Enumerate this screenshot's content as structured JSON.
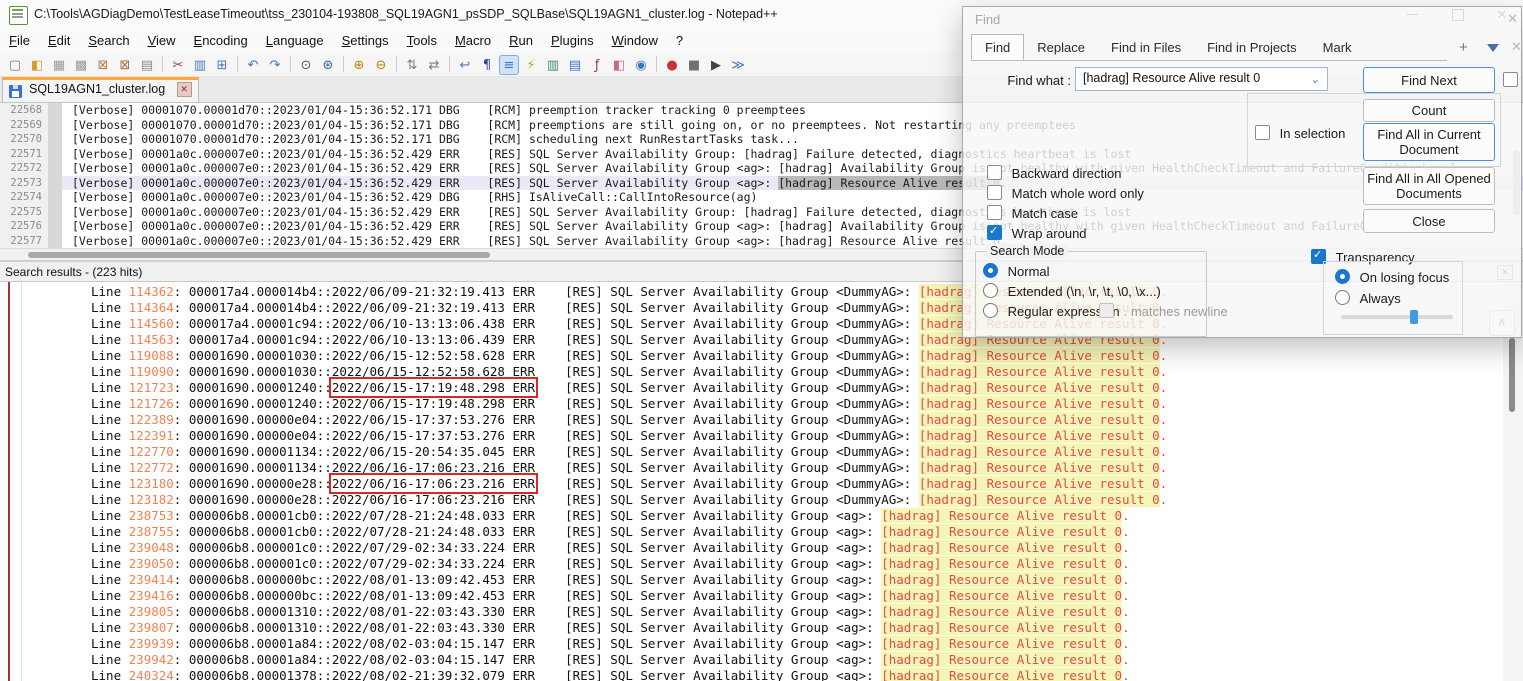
{
  "window": {
    "title": "C:\\Tools\\AGDiagDemo\\TestLeaseTimeout\\tss_230104-193808_SQL19AGN1_psSDP_SQLBase\\SQL19AGN1_cluster.log - Notepad++"
  },
  "menu": {
    "items": [
      "File",
      "Edit",
      "Search",
      "View",
      "Encoding",
      "Language",
      "Settings",
      "Tools",
      "Macro",
      "Run",
      "Plugins",
      "Window",
      "?"
    ]
  },
  "toolbar": {
    "icons": [
      {
        "name": "new-file-icon",
        "glyph": "▢",
        "color": "#7a7a7a"
      },
      {
        "name": "open-file-icon",
        "glyph": "◧",
        "color": "#d79b2e"
      },
      {
        "name": "save-icon",
        "glyph": "▦",
        "color": "#9a9a9a"
      },
      {
        "name": "save-all-icon",
        "glyph": "▩",
        "color": "#9a9a9a"
      },
      {
        "name": "close-file-icon",
        "glyph": "⊠",
        "color": "#b97a4a"
      },
      {
        "name": "close-all-files-icon",
        "glyph": "⊠",
        "color": "#a96a3a"
      },
      {
        "name": "print-icon",
        "glyph": "▤",
        "color": "#8a8a8a",
        "sep_after": true
      },
      {
        "name": "cut-icon",
        "glyph": "✂",
        "color": "#b0392e"
      },
      {
        "name": "copy-icon",
        "glyph": "▥",
        "color": "#4a78c0"
      },
      {
        "name": "paste-icon",
        "glyph": "⊞",
        "color": "#4a78c0",
        "sep_after": true
      },
      {
        "name": "undo-icon",
        "glyph": "↶",
        "color": "#3f74c4"
      },
      {
        "name": "redo-icon",
        "glyph": "↷",
        "color": "#3f74c4",
        "sep_after": true
      },
      {
        "name": "find-icon",
        "glyph": "⊙",
        "color": "#555555"
      },
      {
        "name": "replace-icon",
        "glyph": "⊛",
        "color": "#2f5fa0",
        "sep_after": true
      },
      {
        "name": "zoom-in-icon",
        "glyph": "⊕",
        "color": "#b8860b"
      },
      {
        "name": "zoom-out-icon",
        "glyph": "⊖",
        "color": "#b8860b",
        "sep_after": true
      },
      {
        "name": "sync-vertical-icon",
        "glyph": "⇅",
        "color": "#7a7a7a"
      },
      {
        "name": "sync-horizontal-icon",
        "glyph": "⇄",
        "color": "#7a7a7a",
        "sep_after": true
      },
      {
        "name": "word-wrap-icon",
        "glyph": "↩",
        "color": "#4a78c0"
      },
      {
        "name": "show-all-characters-icon",
        "glyph": "¶",
        "color": "#2b4a9e"
      },
      {
        "name": "indent-guide-icon",
        "glyph": "≡",
        "color": "#3f74c4",
        "pressed": true
      },
      {
        "name": "user-defined-language-icon",
        "glyph": "⚡",
        "color": "#d79b2e"
      },
      {
        "name": "document-map-icon",
        "glyph": "▥",
        "color": "#3f8f5f"
      },
      {
        "name": "document-list-icon",
        "glyph": "▤",
        "color": "#3f74c4"
      },
      {
        "name": "function-list-icon",
        "glyph": "ƒ",
        "color": "#a04040"
      },
      {
        "name": "folder-as-workspace-icon",
        "glyph": "◧",
        "color": "#c46a8a"
      },
      {
        "name": "monitoring-eye-icon",
        "glyph": "◉",
        "color": "#3f74c4",
        "sep_after": true
      },
      {
        "name": "record-macro-icon",
        "glyph": "●",
        "color": "#c83232"
      },
      {
        "name": "stop-macro-icon",
        "glyph": "■",
        "color": "#707070"
      },
      {
        "name": "play-macro-icon",
        "glyph": "▶",
        "color": "#444444"
      },
      {
        "name": "run-macro-multiple-icon",
        "glyph": "≫",
        "color": "#3f74c4"
      }
    ]
  },
  "tabbar": {
    "active_tab": "SQL19AGN1_cluster.log"
  },
  "editor": {
    "lines": [
      {
        "num": "22568",
        "text": "[Verbose] 00001070.00001d70::2023/01/04-15:36:52.171 DBG    [RCM] preemption tracker tracking 0 preemptees"
      },
      {
        "num": "22569",
        "text": "[Verbose] 00001070.00001d70::2023/01/04-15:36:52.171 DBG    [RCM] preemptions are still going on, or no preemptees. Not restarting any preemptees"
      },
      {
        "num": "22570",
        "text": "[Verbose] 00001070.00001d70::2023/01/04-15:36:52.171 DBG    [RCM] scheduling next RunRestartTasks task..."
      },
      {
        "num": "22571",
        "text": "[Verbose] 00001a0c.000007e0::2023/01/04-15:36:52.429 ERR    [RES] SQL Server Availability Group: [hadrag] Failure detected, diagnostics heartbeat is lost"
      },
      {
        "num": "22572",
        "text": "[Verbose] 00001a0c.000007e0::2023/01/04-15:36:52.429 ERR    [RES] SQL Server Availability Group <ag>: [hadrag] Availability Group is not healthy with given HealthCheckTimeout and FailureConditionLevel"
      },
      {
        "num": "22573",
        "text": "[Verbose] 00001a0c.000007e0::2023/01/04-15:36:52.429 ERR    [RES] SQL Server Availability Group <ag>: [hadrag] Resource Alive result 0.",
        "match": "[hadrag] Resource Alive result 0",
        "selected": true
      },
      {
        "num": "22574",
        "text": "[Verbose] 00001a0c.000007e0::2023/01/04-15:36:52.429 DBG    [RHS] IsAliveCall::CallIntoResource(ag)"
      },
      {
        "num": "22575",
        "text": "[Verbose] 00001a0c.000007e0::2023/01/04-15:36:52.429 ERR    [RES] SQL Server Availability Group: [hadrag] Failure detected, diagnostics heartbeat is lost"
      },
      {
        "num": "22576",
        "text": "[Verbose] 00001a0c.000007e0::2023/01/04-15:36:52.429 ERR    [RES] SQL Server Availability Group <ag>: [hadrag] Availability Group is not healthy with given HealthCheckTimeout and FailureConditionLevel"
      },
      {
        "num": "22577",
        "text": "[Verbose] 00001a0c.000007e0::2023/01/04-15:36:52.429 ERR    [RES] SQL Server Availability Group <ag>: [hadrag] Resource Alive result 0."
      }
    ]
  },
  "results_panel": {
    "header": "Search results - (223 hits)",
    "templates": {
      "line_label": "Line",
      "sep": "::",
      "level": "ERR",
      "gap": "    ",
      "res_prefix": "[RES] SQL Server Availability Group",
      "match": "[hadrag] Resource Alive result 0",
      "tail": "."
    },
    "rows": [
      {
        "line": "114362",
        "thread": "000017a4.000014b4",
        "ts": "2022/06/09-21:32:19.413",
        "group": "DummyAG",
        "boxed": false
      },
      {
        "line": "114364",
        "thread": "000017a4.000014b4",
        "ts": "2022/06/09-21:32:19.413",
        "group": "DummyAG",
        "boxed": false
      },
      {
        "line": "114560",
        "thread": "000017a4.00001c94",
        "ts": "2022/06/10-13:13:06.438",
        "group": "DummyAG",
        "boxed": false
      },
      {
        "line": "114563",
        "thread": "000017a4.00001c94",
        "ts": "2022/06/10-13:13:06.439",
        "group": "DummyAG",
        "boxed": false
      },
      {
        "line": "119088",
        "thread": "00001690.00001030",
        "ts": "2022/06/15-12:52:58.628",
        "group": "DummyAG",
        "boxed": false
      },
      {
        "line": "119090",
        "thread": "00001690.00001030",
        "ts": "2022/06/15-12:52:58.628",
        "group": "DummyAG",
        "boxed": false
      },
      {
        "line": "121723",
        "thread": "00001690.00001240",
        "ts": "2022/06/15-17:19:48.298",
        "group": "DummyAG",
        "boxed": true
      },
      {
        "line": "121726",
        "thread": "00001690.00001240",
        "ts": "2022/06/15-17:19:48.298",
        "group": "DummyAG",
        "boxed": false
      },
      {
        "line": "122389",
        "thread": "00001690.00000e04",
        "ts": "2022/06/15-17:37:53.276",
        "group": "DummyAG",
        "boxed": false
      },
      {
        "line": "122391",
        "thread": "00001690.00000e04",
        "ts": "2022/06/15-17:37:53.276",
        "group": "DummyAG",
        "boxed": false
      },
      {
        "line": "122770",
        "thread": "00001690.00001134",
        "ts": "2022/06/15-20:54:35.045",
        "group": "DummyAG",
        "boxed": false
      },
      {
        "line": "122772",
        "thread": "00001690.00001134",
        "ts": "2022/06/16-17:06:23.216",
        "group": "DummyAG",
        "boxed": false
      },
      {
        "line": "123180",
        "thread": "00001690.00000e28",
        "ts": "2022/06/16-17:06:23.216",
        "group": "DummyAG",
        "boxed": true
      },
      {
        "line": "123182",
        "thread": "00001690.00000e28",
        "ts": "2022/06/16-17:06:23.216",
        "group": "DummyAG",
        "boxed": false
      },
      {
        "line": "238753",
        "thread": "000006b8.00001cb0",
        "ts": "2022/07/28-21:24:48.033",
        "group": "ag",
        "boxed": false
      },
      {
        "line": "238755",
        "thread": "000006b8.00001cb0",
        "ts": "2022/07/28-21:24:48.033",
        "group": "ag",
        "boxed": false
      },
      {
        "line": "239048",
        "thread": "000006b8.000001c0",
        "ts": "2022/07/29-02:34:33.224",
        "group": "ag",
        "boxed": false
      },
      {
        "line": "239050",
        "thread": "000006b8.000001c0",
        "ts": "2022/07/29-02:34:33.224",
        "group": "ag",
        "boxed": false
      },
      {
        "line": "239414",
        "thread": "000006b8.000000bc",
        "ts": "2022/08/01-13:09:42.453",
        "group": "ag",
        "boxed": false
      },
      {
        "line": "239416",
        "thread": "000006b8.000000bc",
        "ts": "2022/08/01-13:09:42.453",
        "group": "ag",
        "boxed": false
      },
      {
        "line": "239805",
        "thread": "000006b8.00001310",
        "ts": "2022/08/01-22:03:43.330",
        "group": "ag",
        "boxed": false
      },
      {
        "line": "239807",
        "thread": "000006b8.00001310",
        "ts": "2022/08/01-22:03:43.330",
        "group": "ag",
        "boxed": false
      },
      {
        "line": "239939",
        "thread": "000006b8.00001a84",
        "ts": "2022/08/02-03:04:15.147",
        "group": "ag",
        "boxed": false
      },
      {
        "line": "239942",
        "thread": "000006b8.00001a84",
        "ts": "2022/08/02-03:04:15.147",
        "group": "ag",
        "boxed": false
      },
      {
        "line": "240324",
        "thread": "000006b8.00001378",
        "ts": "2022/08/02-21:39:32.079",
        "group": "ag",
        "boxed": false
      }
    ]
  },
  "find_dialog": {
    "title": "Find",
    "tabs": [
      "Find",
      "Replace",
      "Find in Files",
      "Find in Projects",
      "Mark"
    ],
    "active_tab": "Find",
    "find_what_label": "Find what :",
    "find_what_value": "[hadrag] Resource Alive result 0",
    "buttons": {
      "find_next": "Find Next",
      "count": "Count",
      "find_all_current": "Find All in Current Document",
      "find_all_opened": "Find All in All Opened Documents",
      "close": "Close"
    },
    "in_selection": {
      "label": "In selection",
      "checked": false
    },
    "backward_direction": {
      "label": "Backward direction",
      "checked": false
    },
    "match_whole_word": {
      "label": "Match whole word only",
      "checked": false
    },
    "match_case": {
      "label": "Match case",
      "checked": false
    },
    "wrap_around": {
      "label": "Wrap around",
      "checked": true
    },
    "search_mode": {
      "label": "Search Mode",
      "normal": {
        "label": "Normal",
        "selected": true
      },
      "extended": {
        "label": "Extended (\\n, \\r, \\t, \\0, \\x...)",
        "selected": false
      },
      "regex": {
        "label": "Regular expression",
        "selected": false
      },
      "matches_newline": {
        "label": ". matches newline",
        "checked": false
      }
    },
    "transparency": {
      "label": "Transparency",
      "checked": true,
      "on_losing_focus": {
        "label": "On losing focus",
        "selected": true
      },
      "always": {
        "label": "Always",
        "selected": false
      },
      "slider_percent": 62
    }
  },
  "colors": {
    "accent_blue": "#4a90d9",
    "match_highlight_bg": "#f6f6b4",
    "match_text_red": "#e04b4b",
    "line_number_orange": "#ef8354",
    "annotation_red": "#e12424",
    "tab_accent_orange": "#ffa63e"
  }
}
